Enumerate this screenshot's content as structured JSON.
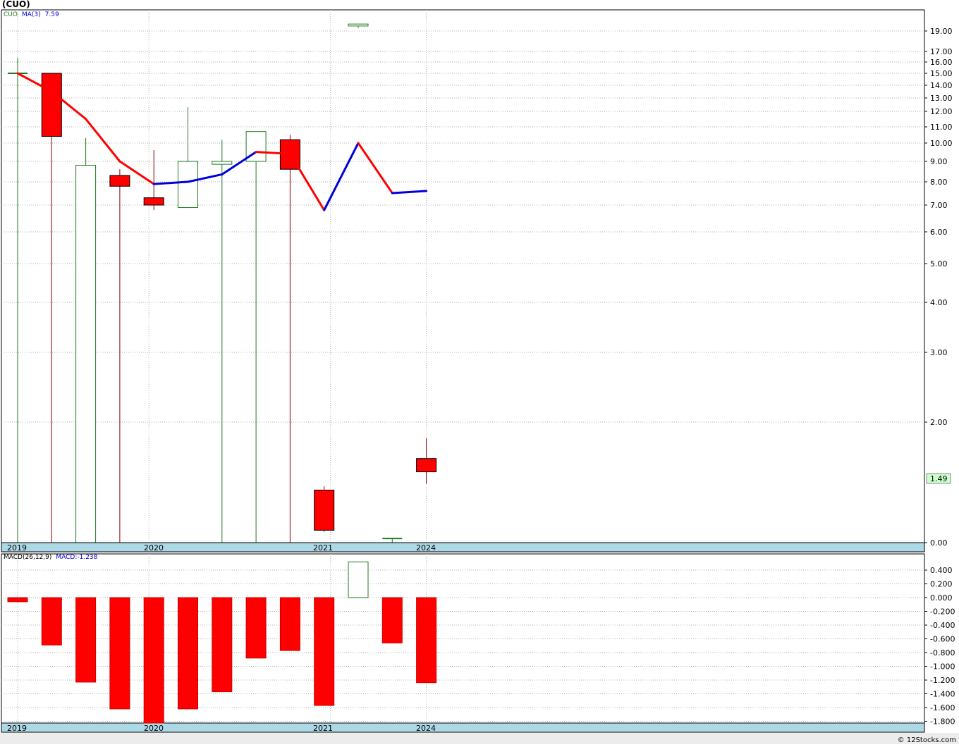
{
  "title": "(CUO)",
  "credit": "© 12Stocks.com",
  "colors": {
    "up": "#1f7a1f",
    "down": "#ff0000",
    "ma_up": "#0000dd",
    "ma_down": "#ff0000",
    "axis_bar": "#add8e6",
    "grid": "#b0b0b0",
    "last_price_badge": "#ccffcc"
  },
  "price_panel": {
    "legend": {
      "symbol": "CUO",
      "ma_label": "MA(3)",
      "ma_value": "7.59"
    },
    "last_price": "1.49",
    "y_tick_labels": [
      "19.00",
      "17.00",
      "16.00",
      "15.00",
      "14.00",
      "13.00",
      "12.00",
      "11.00",
      "10.00",
      "9.00",
      "8.00",
      "7.00",
      "6.00",
      "5.00",
      "4.00",
      "3.00",
      "2.00",
      "0.00"
    ],
    "x_labels": [
      "2019",
      "2020",
      "2021",
      "2024"
    ]
  },
  "macd_panel": {
    "legend": {
      "label": "MACD(26,12,9)",
      "value_label": "MACD:-1.238"
    },
    "y_tick_labels": [
      "0.400",
      "0.200",
      "0.000",
      "-0.200",
      "-0.400",
      "-0.600",
      "-0.800",
      "-1.000",
      "-1.200",
      "-1.400",
      "-1.600",
      "-1.800"
    ],
    "x_labels": [
      "2019",
      "2020",
      "2021",
      "2024"
    ]
  },
  "chart_data": [
    {
      "type": "candlestick",
      "title": "(CUO)",
      "y_scale": "log",
      "x_labels": [
        "2019",
        "2020",
        "2021",
        "2024"
      ],
      "candles": [
        {
          "open": 15.0,
          "high": 16.4,
          "low": 0.0,
          "close": 15.0
        },
        {
          "open": 15.0,
          "high": 15.0,
          "low": 0.0,
          "close": 10.4
        },
        {
          "open": 0.0,
          "high": 10.3,
          "low": 0.0,
          "close": 8.8
        },
        {
          "open": 8.3,
          "high": 8.6,
          "low": 0.0,
          "close": 7.8
        },
        {
          "open": 7.3,
          "high": 9.6,
          "low": 6.8,
          "close": 7.0
        },
        {
          "open": 6.9,
          "high": 12.3,
          "low": 6.9,
          "close": 9.0
        },
        {
          "open": 8.85,
          "high": 10.2,
          "low": 0.0,
          "close": 9.0
        },
        {
          "open": 9.0,
          "high": 10.7,
          "low": 0.0,
          "close": 10.7
        },
        {
          "open": 10.2,
          "high": 10.5,
          "low": 0.0,
          "close": 8.6
        },
        {
          "open": 1.35,
          "high": 1.38,
          "low": 1.06,
          "close": 1.07
        },
        {
          "open": 19.5,
          "high": 19.7,
          "low": 19.3,
          "close": 19.7
        },
        {
          "open": 1.02,
          "high": 1.02,
          "low": 0.0,
          "close": 1.02
        },
        {
          "open": 1.62,
          "high": 1.82,
          "low": 1.4,
          "close": 1.5
        }
      ],
      "series": [
        {
          "name": "MA(3)",
          "values": [
            15.0,
            13.5,
            11.5,
            9.0,
            7.9,
            8.0,
            8.35,
            9.5,
            9.4,
            6.8,
            10.0,
            7.5,
            7.59
          ]
        }
      ]
    },
    {
      "type": "bar",
      "title": "MACD(26,12,9)",
      "x_labels": [
        "2019",
        "2020",
        "2021",
        "2024"
      ],
      "ylim": [
        -1.85,
        0.55
      ],
      "values": [
        -0.06,
        -0.69,
        -1.23,
        -1.62,
        -1.85,
        -1.62,
        -1.37,
        -0.88,
        -0.77,
        -1.57,
        0.52,
        -0.66,
        -1.238
      ]
    }
  ]
}
